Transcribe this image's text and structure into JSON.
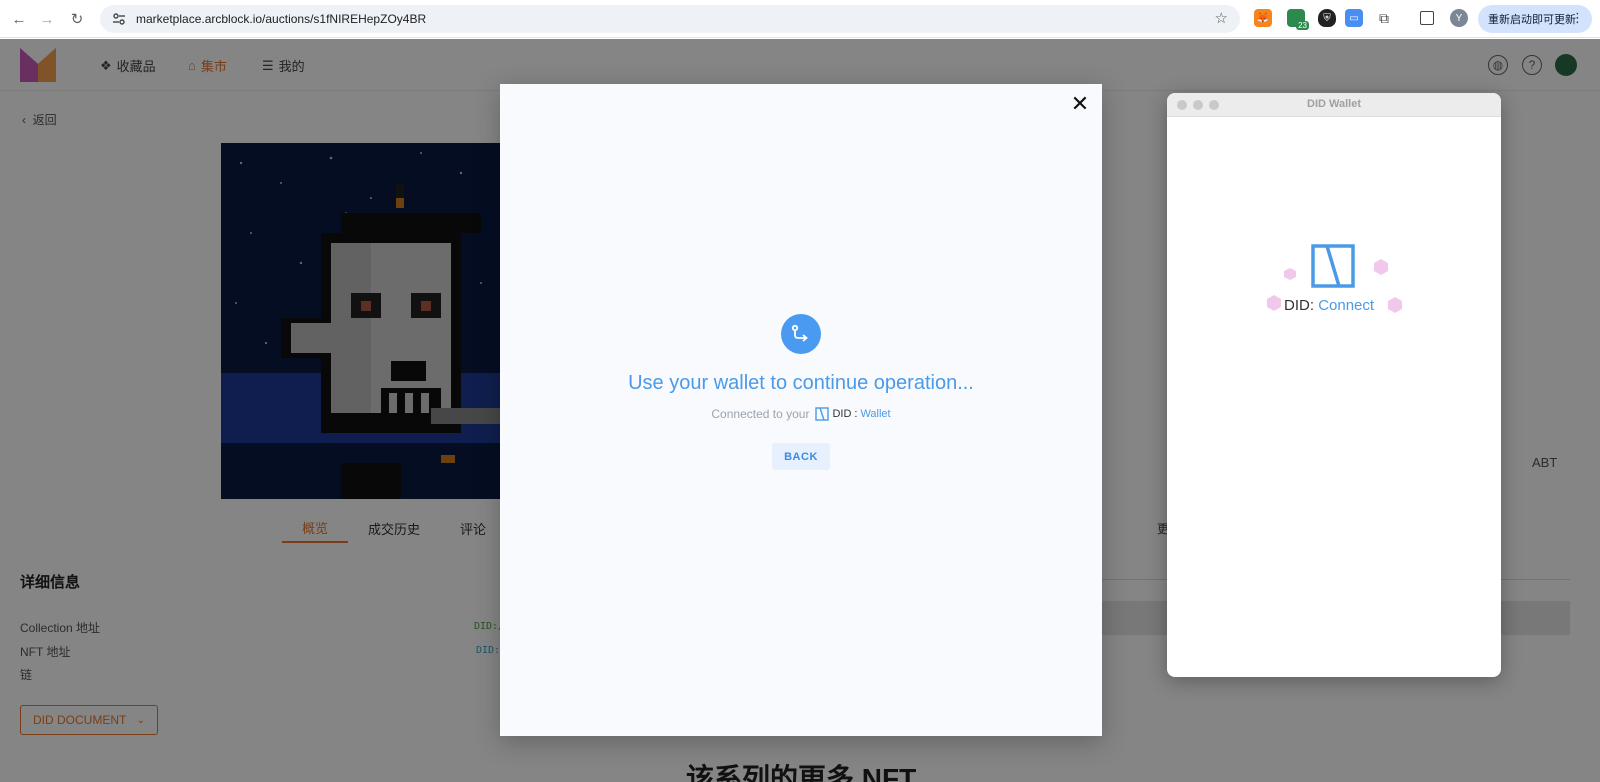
{
  "browser": {
    "url": "marketplace.arcblock.io/auctions/s1fNIREHepZOy4BR",
    "profile_initial": "Y",
    "extension_badge": "23",
    "update_button": "重新启动即可更新"
  },
  "site": {
    "nav": {
      "collections": "收藏品",
      "market": "集市",
      "mine": "我的"
    },
    "back": "返回",
    "tabs": [
      "概览",
      "成交历史",
      "评论"
    ],
    "details": {
      "title": "详细信息",
      "collection_label": "Collection 地址",
      "collection_value": "DID:/",
      "nft_label": "NFT 地址",
      "nft_value": "DID:",
      "chain_label": "链"
    },
    "did_document_button": "DID DOCUMENT",
    "more_title": "该系列的更多 NFT",
    "currency": "ABT",
    "fragment": "更"
  },
  "modal": {
    "heading": "Use your wallet to continue operation...",
    "connected_text": "Connected to your",
    "brand_did": "DID",
    "brand_wallet": "Wallet",
    "back_button": "BACK",
    "close_symbol": "✕"
  },
  "wallet_window": {
    "title": "DID Wallet",
    "brand_did": "DID",
    "brand_connect": "Connect"
  },
  "colors": {
    "accent_orange": "#e8772e",
    "modal_blue": "#4a9ae8",
    "did_pink": "#f1c8ec"
  }
}
